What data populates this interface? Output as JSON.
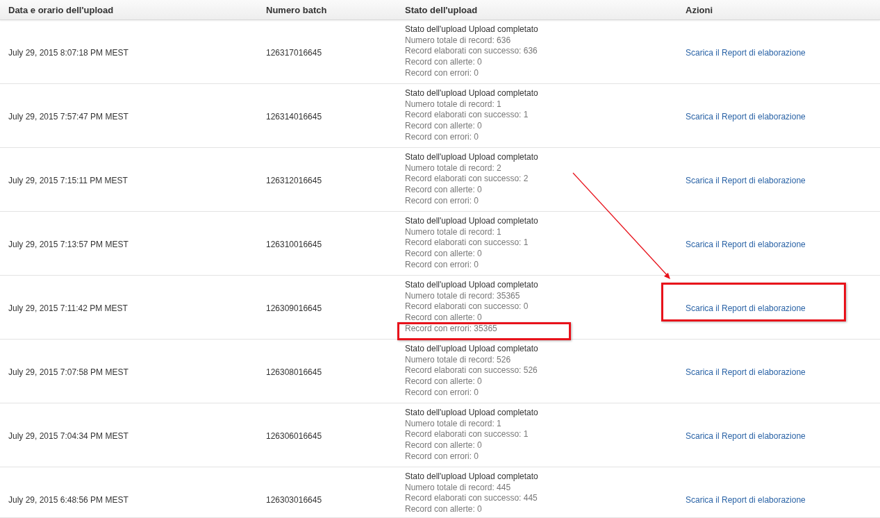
{
  "columns": [
    "Data e orario dell'upload",
    "Numero batch",
    "Stato dell'upload",
    "Azioni"
  ],
  "rows": [
    {
      "date": "July 29, 2015 8:07:18 PM MEST",
      "batch": "126317016645",
      "status": "Stato dell'upload Upload completato",
      "details": [
        "Numero totale di record: 636",
        "Record elaborati con successo: 636",
        "Record con allerte: 0",
        "Record con errori: 0"
      ],
      "action": "Scarica il Report di elaborazione",
      "errors_highlighted": false,
      "action_highlighted": false
    },
    {
      "date": "July 29, 2015 7:57:47 PM MEST",
      "batch": "126314016645",
      "status": "Stato dell'upload Upload completato",
      "details": [
        "Numero totale di record: 1",
        "Record elaborati con successo: 1",
        "Record con allerte: 0",
        "Record con errori: 0"
      ],
      "action": "Scarica il Report di elaborazione",
      "errors_highlighted": false,
      "action_highlighted": false
    },
    {
      "date": "July 29, 2015 7:15:11 PM MEST",
      "batch": "126312016645",
      "status": "Stato dell'upload Upload completato",
      "details": [
        "Numero totale di record: 2",
        "Record elaborati con successo: 2",
        "Record con allerte: 0",
        "Record con errori: 0"
      ],
      "action": "Scarica il Report di elaborazione",
      "errors_highlighted": false,
      "action_highlighted": false
    },
    {
      "date": "July 29, 2015 7:13:57 PM MEST",
      "batch": "126310016645",
      "status": "Stato dell'upload Upload completato",
      "details": [
        "Numero totale di record: 1",
        "Record elaborati con successo: 1",
        "Record con allerte: 0",
        "Record con errori: 0"
      ],
      "action": "Scarica il Report di elaborazione",
      "errors_highlighted": false,
      "action_highlighted": false
    },
    {
      "date": "July 29, 2015 7:11:42 PM MEST",
      "batch": "126309016645",
      "status": "Stato dell'upload Upload completato",
      "details": [
        "Numero totale di record: 35365",
        "Record elaborati con successo: 0",
        "Record con allerte: 0",
        "Record con errori: 35365"
      ],
      "action": "Scarica il Report di elaborazione",
      "errors_highlighted": true,
      "action_highlighted": true
    },
    {
      "date": "July 29, 2015 7:07:58 PM MEST",
      "batch": "126308016645",
      "status": "Stato dell'upload Upload completato",
      "details": [
        "Numero totale di record: 526",
        "Record elaborati con successo: 526",
        "Record con allerte: 0",
        "Record con errori: 0"
      ],
      "action": "Scarica il Report di elaborazione",
      "errors_highlighted": false,
      "action_highlighted": false
    },
    {
      "date": "July 29, 2015 7:04:34 PM MEST",
      "batch": "126306016645",
      "status": "Stato dell'upload Upload completato",
      "details": [
        "Numero totale di record: 1",
        "Record elaborati con successo: 1",
        "Record con allerte: 0",
        "Record con errori: 0"
      ],
      "action": "Scarica il Report di elaborazione",
      "errors_highlighted": false,
      "action_highlighted": false
    },
    {
      "date": "July 29, 2015 6:48:56 PM MEST",
      "batch": "126303016645",
      "status": "Stato dell'upload Upload completato",
      "details": [
        "Numero totale di record: 445",
        "Record elaborati con successo: 445",
        "Record con allerte: 0"
      ],
      "action": "Scarica il Report di elaborazione",
      "errors_highlighted": false,
      "action_highlighted": false
    }
  ],
  "annotation_arrow": true
}
